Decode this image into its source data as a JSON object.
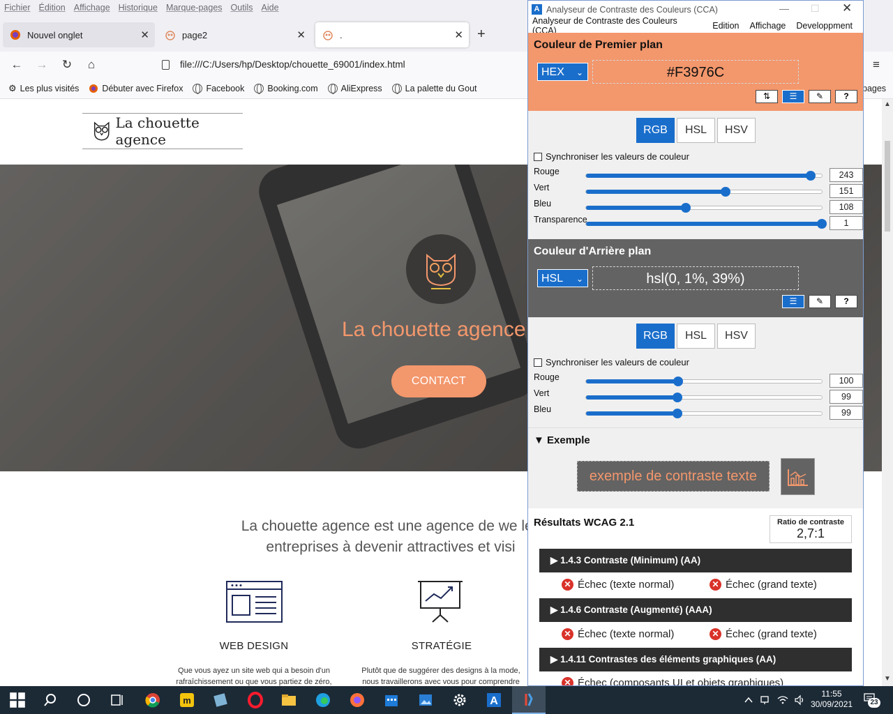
{
  "firefox": {
    "menu": [
      "Fichier",
      "Édition",
      "Affichage",
      "Historique",
      "Marque-pages",
      "Outils",
      "Aide"
    ],
    "tabs": [
      {
        "label": "Nouvel onglet"
      },
      {
        "label": "page2"
      },
      {
        "label": "."
      }
    ],
    "url": "file:///C:/Users/hp/Desktop/chouette_69001/index.html",
    "bookmarks": [
      "Les plus visités",
      "Débuter avec Firefox",
      "Facebook",
      "Booking.com",
      "AliExpress",
      "La palette du Gout"
    ],
    "bookmarks_overflow": "pages"
  },
  "site": {
    "logo_text": "La chouette agence",
    "hero_title": "La chouette agence",
    "contact_label": "CONTACT",
    "intro": "La chouette agence est une agence de we les entreprises à devenir attractives et visi",
    "services": [
      {
        "title": "WEB DESIGN",
        "desc": "Que vous ayez un site web qui a besoin d'un rafraîchissement ou que vous partiez de zéro,"
      },
      {
        "title": "STRATÉGIE",
        "desc": "Plutôt que de suggérer des designs à la mode, nous travaillerons avec vous pour comprendre"
      }
    ],
    "brand_color": "#F3976C"
  },
  "cca": {
    "title": "Analyseur de Contraste des Couleurs (CCA)",
    "menu": [
      "Analyseur de Contraste des Couleurs (CCA)",
      "Edition",
      "Affichage",
      "Developpment"
    ],
    "foreground": {
      "heading": "Couleur de Premier plan",
      "format": "HEX",
      "value": "#F3976C",
      "modes": [
        "RGB",
        "HSL",
        "HSV"
      ],
      "sync_label": "Synchroniser les valeurs de couleur",
      "channels": [
        {
          "label": "Rouge",
          "value": "243",
          "level": 0.953
        },
        {
          "label": "Vert",
          "value": "151",
          "level": 0.592
        },
        {
          "label": "Bleu",
          "value": "108",
          "level": 0.424
        },
        {
          "label": "Transparence",
          "value": "1",
          "level": 1.0
        }
      ]
    },
    "background": {
      "heading": "Couleur d'Arrière plan",
      "format": "HSL",
      "value": "hsl(0, 1%, 39%)",
      "modes": [
        "RGB",
        "HSL",
        "HSV"
      ],
      "sync_label": "Synchroniser les valeurs de couleur",
      "channels": [
        {
          "label": "Rouge",
          "value": "100",
          "level": 0.392
        },
        {
          "label": "Vert",
          "value": "99",
          "level": 0.388
        },
        {
          "label": "Bleu",
          "value": "99",
          "level": 0.388
        }
      ]
    },
    "example": {
      "heading": "Exemple",
      "text": "exemple de contraste texte"
    },
    "results": {
      "heading": "Résultats WCAG 2.1",
      "ratio_label": "Ratio de contraste",
      "ratio_value": "2,7:1",
      "criteria": [
        {
          "title": "1.4.3 Contraste (Minimum) (AA)",
          "results": [
            "Échec (texte normal)",
            "Échec (grand texte)"
          ]
        },
        {
          "title": "1.4.6 Contraste (Augmenté) (AAA)",
          "results": [
            "Échec (texte normal)",
            "Échec (grand texte)"
          ]
        },
        {
          "title": "1.4.11 Contrastes des éléments graphiques (AA)",
          "results": [
            "Échec (composants UI et objets graphiques)"
          ]
        }
      ]
    },
    "fg_color": "#F3976C",
    "bg_color": "#636363",
    "accent": "#1A6ECB"
  },
  "taskbar": {
    "time": "11:55",
    "date": "30/09/2021",
    "notifications": "23"
  }
}
